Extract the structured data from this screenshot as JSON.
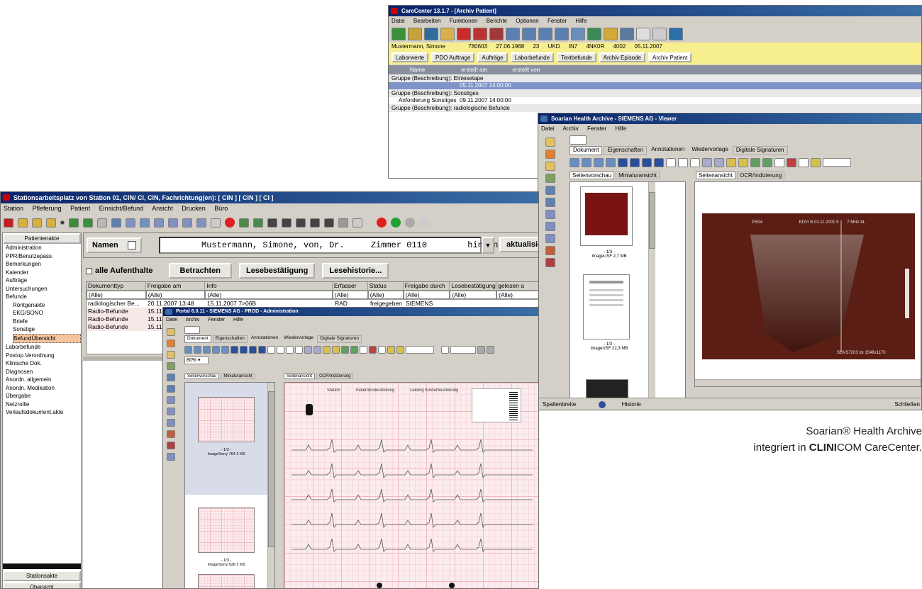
{
  "caption": {
    "line1": "Soarian® Health Archive",
    "line2_brand_bold": "CLINI",
    "line2_prefix": "integriert in ",
    "line2_suffix": "COM CareCenter."
  },
  "back_window": {
    "title": "CareCenter 13.1.7 - [Archiv Patient]",
    "menu": [
      "Datei",
      "Bearbeiten",
      "Funktionen",
      "Berichte",
      "Optionen",
      "Fenster",
      "Hilfe"
    ],
    "patient_line": [
      "Mustermann, Simone",
      "780603",
      "27.06.1968",
      "23",
      "UKD",
      "IN7",
      "4NK0R",
      "4002",
      "05.11.2007"
    ],
    "tabs": [
      "Laborwerte",
      "PDO Auftrage",
      "Aufträge",
      "Laborbefunde",
      "Textbefunde",
      "Archiv Episode",
      "Archiv Patient"
    ],
    "grid_headers": [
      "Name",
      "erstellt am",
      "erstellt von"
    ],
    "groups": [
      {
        "label": "Gruppe (Beschreibung): Einlesetape",
        "rows": [
          [
            "",
            "05.11.2007 14:00:00"
          ]
        ]
      },
      {
        "label": "Gruppe (Beschreibung): Sonstiges",
        "rows": [
          [
            "Anforderung Sonstiges",
            "09.11.2007 14:00:00"
          ]
        ]
      },
      {
        "label": "Gruppe (Beschreibung): radiologische Befunde",
        "rows": []
      }
    ],
    "status": [
      "Spaltenbreite",
      "Historie"
    ],
    "status_right": "Schließen"
  },
  "viewer_window": {
    "title": "Soarian Health Archive - SIEMENS AG - Viewer",
    "menu": [
      "Datei",
      "Archiv",
      "Fenster",
      "Hilfe"
    ],
    "tabs": [
      "Dokument",
      "Eigenschaften",
      "Annotationen",
      "Wiedervorlage",
      "Digitale Signaturen"
    ],
    "left_tabs": [
      "Seitenvorschau",
      "Miniaturansicht"
    ],
    "right_tabs": [
      "Seitenansicht",
      "OCR/Indizierung"
    ],
    "thumbs": [
      "- 1/3 -\nImageUSF 2,7 MB",
      "- 1/3 -\nImageUSF 22,3 MB"
    ],
    "image_overlay": [
      "P.504",
      "EDVI B 03.11.2001 9",
      "7 MHz  8L"
    ],
    "image_bottom": [
      "SDVS7203 dx 1548x1170"
    ]
  },
  "main_window": {
    "title": "Stationsarbeitsplatz von Station 01, CIN/ CI, CIN, Fachrichtung(en): [ CIN ] [ CIN ] [ CI ]",
    "menu": [
      "Station",
      "Pfleferung",
      "Patient",
      "Einsicht/Befund",
      "Ansicht",
      "Drucken",
      "Büro"
    ],
    "nav_header": "Patientenakte",
    "nav_items": [
      "Administration",
      "PPR/Benutzepass.",
      "Bemerkungen",
      "Kalender",
      "Aufträge",
      "Untersuchungen",
      "Befunde",
      "Laborbefunde",
      "Postop.Verordnung",
      "Klinische Dok.",
      "Diagnosen",
      "Anordn. allgemein",
      "Anordn. Medikation",
      "Übergabe",
      "Netzrollie",
      "Verlaufsdokument.akte"
    ],
    "befunde_children": [
      "Röntgenakte",
      "EKG/SONO",
      "Briefe",
      "Sonstige",
      "BefundÜbersicht"
    ],
    "nav_bottom": [
      "Stationsakte",
      "Übersicht"
    ],
    "name_label": "Namen",
    "name_value": "Mustermann, Simone, von, Dr.",
    "room_label": "Zimmer 0110",
    "side_label": "hinten links",
    "refresh_label": "aktualisieren",
    "all_stays_label": "alle Aufenthalte",
    "buttons": [
      "Betrachten",
      "Lesebestätigung",
      "Lesehistorie..."
    ],
    "columns": [
      "Dokumenttyp",
      "Freigabe am",
      "Info",
      "Erfasser",
      "Status",
      "Freigabe durch",
      "Lesebestätigung",
      "gelesen a"
    ],
    "filters": [
      "(Alle)",
      "(Alle)",
      "(Alle)",
      "(Alle)",
      "(Alle)",
      "(Alle)",
      "(Alle)",
      "(Alle)"
    ],
    "rows": [
      [
        "radiologischer Be...",
        "20.11.2007 13:48",
        "15.11.2007 7>06B",
        "RAD",
        "freigegeben",
        "SIEMENS"
      ],
      [
        "Radio-Befunde",
        "15.11..."
      ],
      [
        "Radio-Befunde",
        "15.11..."
      ],
      [
        "Radio-Befunde",
        "15.11..."
      ]
    ]
  },
  "ecg_window": {
    "title": "Portal 6.0.11 - SIEMENS AG - PROD - Administration",
    "menu": [
      "Datei",
      "Archiv",
      "Fenster",
      "Hilfe"
    ],
    "tabs": [
      "Dokument",
      "Eigenschaften",
      "Annotationen",
      "Wiedervorlage",
      "Digitale Signaturen"
    ],
    "zoom": "80%",
    "left_tabs": [
      "Seitenvorschau",
      "Miniaturansicht"
    ],
    "right_tabs": [
      "Seitenansicht",
      "OCR/Indizierung"
    ],
    "thumbs": [
      "- 1/3 -\nImageSorry 764 2 KB",
      "- 1/3 -\nImageSorry 938 2 KB"
    ],
    "ecg_header": [
      "Station",
      "Patientenbeurteilung",
      "Leitung Kinderbeurteilung"
    ]
  }
}
